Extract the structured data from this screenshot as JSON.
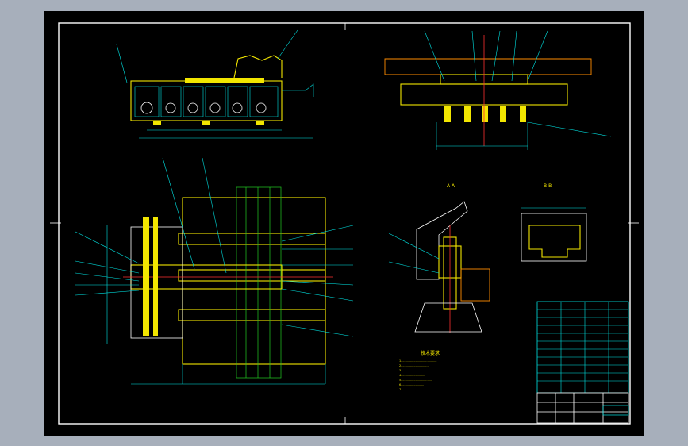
{
  "drawing": {
    "notes_title": "技术要求",
    "notes_lines": [
      "1. ........................................",
      "2. ..............................",
      "3. ....................",
      "4. ..........................",
      "5. ..................................",
      "6. .........................",
      "7. .................."
    ],
    "section_a_label": "A-A",
    "section_b_label": "B-B",
    "colors": {
      "background": "#000000",
      "frame": "#ffffff",
      "outline": "#f2e600",
      "dimension": "#00e5e5",
      "hidden": "#22cc22",
      "center": "#ff3030",
      "title_block": "#00e5e5"
    }
  }
}
